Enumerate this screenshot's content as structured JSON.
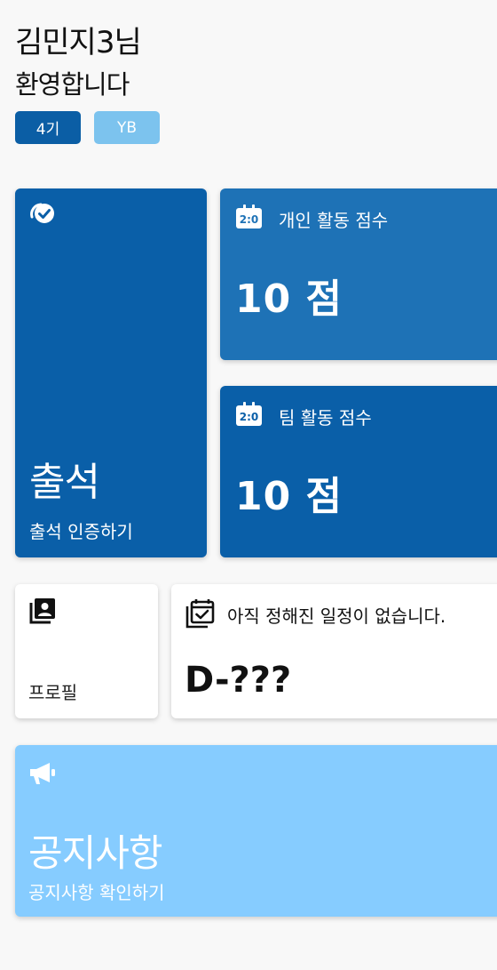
{
  "greeting": {
    "name": "김민지3님",
    "welcome": "환영합니다"
  },
  "badges": {
    "generation": "4기",
    "type": "YB"
  },
  "attendance": {
    "title": "출석",
    "subtitle": "출석 인증하기",
    "icon": "check-circle-icon"
  },
  "personal_score": {
    "label": "개인 활동 점수",
    "value": "10 점",
    "icon": "scoreboard-icon"
  },
  "team_score": {
    "label": "팀 활동 점수",
    "value": "10 점",
    "icon": "scoreboard-icon"
  },
  "profile": {
    "label": "프로필",
    "icon": "profile-card-icon"
  },
  "schedule": {
    "label": "아직 정해진 일정이 없습니다.",
    "dday": "D-???",
    "icon": "calendar-check-icon"
  },
  "notice": {
    "title": "공지사항",
    "subtitle": "공지사항 확인하기",
    "icon": "megaphone-icon"
  },
  "colors": {
    "primary": "#0a5fa8",
    "secondary": "#1e72b6",
    "light_accent": "#86ccff",
    "badge_yb": "#7cc3ee"
  }
}
